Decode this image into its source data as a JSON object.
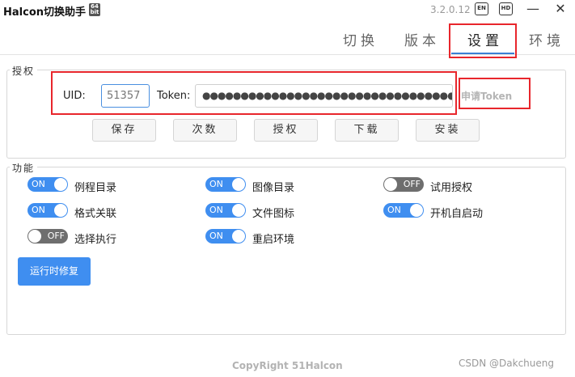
{
  "app": {
    "title": "Halcon切换助手",
    "bits_badge": "64 bit",
    "version": "3.2.0.12"
  },
  "titlebar": {
    "lang_button": "EN",
    "hd_button": "HD",
    "minimize": "—",
    "close": "✕"
  },
  "tabs": [
    {
      "label": "切换",
      "active": false
    },
    {
      "label": "版本",
      "active": false
    },
    {
      "label": "设置",
      "active": true
    },
    {
      "label": "环境",
      "active": false
    }
  ],
  "auth": {
    "group_title": "授权",
    "uid_label": "UID:",
    "uid_value": "51357",
    "token_label": "Token:",
    "token_value": "●●●●●●●●●●●●●●●●●●●●●●●●●●●●●●●●●●●●●●●●",
    "apply_token": "申请Token",
    "buttons": [
      "保存",
      "次数",
      "授权",
      "下载",
      "安装"
    ]
  },
  "features": {
    "group_title": "功能",
    "items": [
      {
        "label": "例程目录",
        "state": "ON"
      },
      {
        "label": "图像目录",
        "state": "ON"
      },
      {
        "label": "试用授权",
        "state": "OFF"
      },
      {
        "label": "格式关联",
        "state": "ON"
      },
      {
        "label": "文件图标",
        "state": "ON"
      },
      {
        "label": "开机自启动",
        "state": "ON"
      },
      {
        "label": "选择执行",
        "state": "OFF"
      },
      {
        "label": "重启环境",
        "state": "ON"
      }
    ],
    "repair_button": "运行时修复"
  },
  "footer": {
    "copyright": "CopyRight 51Halcon",
    "watermark": "CSDN @Dakchueng"
  },
  "colors": {
    "accent": "#3f8ef0",
    "highlight_red": "#e8262c",
    "toggle_off": "#6e6e6e"
  }
}
